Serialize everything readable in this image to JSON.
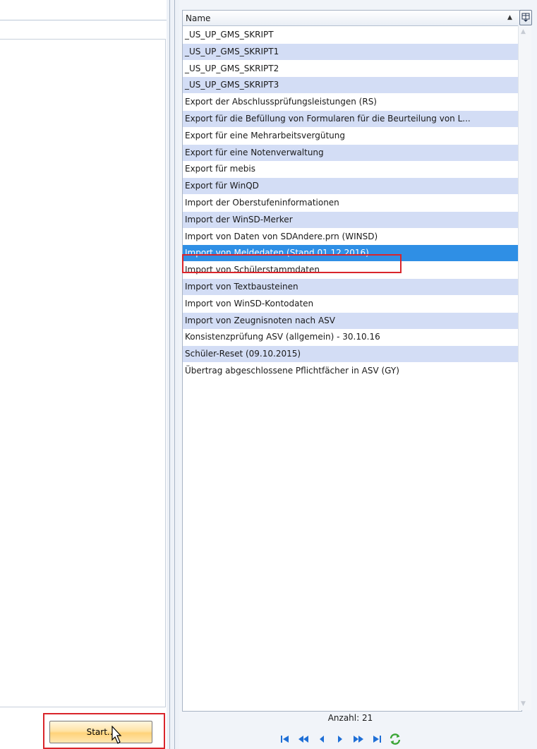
{
  "grid": {
    "column_header": "Name",
    "rows": [
      "_US_UP_GMS_SKRIPT",
      "_US_UP_GMS_SKRIPT1",
      "_US_UP_GMS_SKRIPT2",
      "_US_UP_GMS_SKRIPT3",
      "Export der Abschlussprüfungsleistungen (RS)",
      "Export für die Befüllung von Formularen für die Beurteilung von L...",
      "Export für eine Mehrarbeitsvergütung",
      "Export für eine Notenverwaltung",
      "Export für mebis",
      "Export für WinQD",
      "Import der Oberstufeninformationen",
      "Import der WinSD-Merker",
      "Import von Daten von SDAndere.prn (WINSD)",
      "Import von Meldedaten (Stand 01.12.2016)",
      "Import von Schülerstammdaten",
      "Import von Textbausteinen",
      "Import von WinSD-Kontodaten",
      "Import von Zeugnisnoten nach ASV",
      "Konsistenzprüfung ASV (allgemein) - 30.10.16",
      "Schüler-Reset (09.10.2015)",
      "Übertrag abgeschlossene Pflichtfächer in ASV (GY)"
    ],
    "selected_index": 13,
    "count_label": "Anzahl: 21"
  },
  "buttons": {
    "start_label": "Start..."
  },
  "icons": {
    "sort": "sort-ascending-icon",
    "column_chooser": "column-chooser-icon",
    "nav": [
      "first-page-icon",
      "previous-page-icon",
      "previous-record-icon",
      "next-record-icon",
      "next-page-icon",
      "last-page-icon",
      "refresh-icon"
    ]
  },
  "colors": {
    "row_alt": "#d3ddf5",
    "selected": "#2f8fe5",
    "highlight_border": "#d9252b",
    "nav_blue": "#1f6fd6",
    "refresh_green": "#3aa535"
  }
}
